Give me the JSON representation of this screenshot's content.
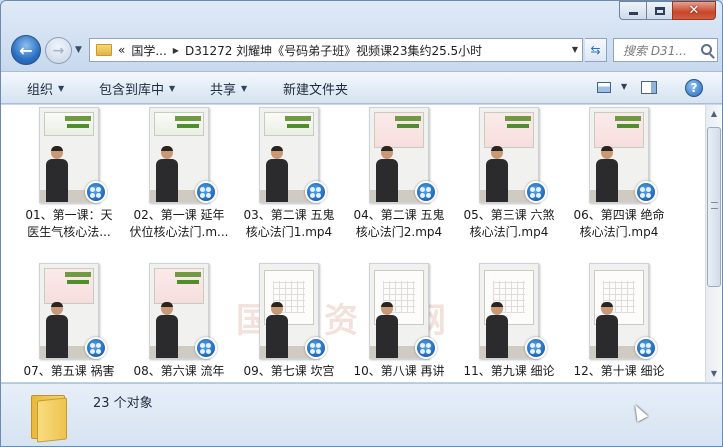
{
  "window": {
    "caption_buttons": {
      "minimize": "–",
      "maximize": "□",
      "close": "✕"
    }
  },
  "nav": {
    "back_glyph": "←",
    "forward_glyph": "→",
    "breadcrumb": {
      "prefix": "«",
      "items": [
        "国学...",
        "D31272 刘耀坤《号码弟子班》视频课23集约25.5小时"
      ]
    },
    "search_placeholder": "搜索 D31..."
  },
  "toolbar": {
    "organize": "组织",
    "include_in_library": "包含到库中",
    "share": "共享",
    "new_folder": "新建文件夹",
    "help": "?"
  },
  "files": [
    {
      "line1": "01、第一课：天",
      "line2": "医生气核心法...",
      "style": "lecture"
    },
    {
      "line1": "02、第一课  延年",
      "line2": "伏位核心法门.m...",
      "style": "lecture"
    },
    {
      "line1": "03、第二课  五鬼",
      "line2": "核心法门1.mp4",
      "style": "lecture"
    },
    {
      "line1": "04、第二课  五鬼",
      "line2": "核心法门2.mp4",
      "style": "pink"
    },
    {
      "line1": "05、第三课  六煞",
      "line2": "核心法门.mp4",
      "style": "pink"
    },
    {
      "line1": "06、第四课 绝命",
      "line2": "核心法门.mp4",
      "style": "pink"
    },
    {
      "line1": "07、第五课  祸害",
      "line2": "",
      "style": "pink"
    },
    {
      "line1": "08、第六课  流年",
      "line2": "",
      "style": "pink"
    },
    {
      "line1": "09、第七课  坎宫",
      "line2": "",
      "style": "board"
    },
    {
      "line1": "10、第八课  再讲",
      "line2": "",
      "style": "board"
    },
    {
      "line1": "11、第九课  细论",
      "line2": "",
      "style": "board"
    },
    {
      "line1": "12、第十课  细论",
      "line2": "",
      "style": "board"
    }
  ],
  "status": {
    "count": "23 个对象"
  },
  "watermark": "国學资源网"
}
